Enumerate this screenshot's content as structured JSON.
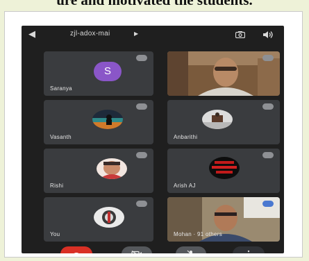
{
  "caption": "ure and motivated the students.",
  "meeting": {
    "code": "zjl-adox-mai",
    "back_icon": "back-arrow-icon",
    "camera_switch_icon": "camera-switch-icon",
    "speaker_icon": "speaker-icon"
  },
  "participants": [
    {
      "name": "Saranya",
      "type": "letter-avatar",
      "letter": "S",
      "color": "#8a56c8",
      "mic": "muted"
    },
    {
      "name": "",
      "type": "video",
      "mic": "muted"
    },
    {
      "name": "Vasanth",
      "type": "photo-avatar",
      "mic": "muted"
    },
    {
      "name": "Anbarithi",
      "type": "photo-avatar",
      "mic": "muted"
    },
    {
      "name": "Rishi",
      "type": "photo-avatar",
      "mic": "muted"
    },
    {
      "name": "Arish AJ",
      "type": "photo-avatar",
      "mic": "muted"
    },
    {
      "name": "You",
      "type": "photo-avatar",
      "mic": "muted"
    },
    {
      "name": "Mohan · 91 others",
      "type": "video",
      "mic": "speaking"
    }
  ],
  "controls": [
    {
      "icon": "hang-up-icon",
      "color": "#d93025"
    },
    {
      "icon": "camera-off-icon",
      "color": "#55585c"
    },
    {
      "icon": "mic-off-icon",
      "color": "#55585c"
    },
    {
      "icon": "more-options-icon",
      "color": "#303236"
    }
  ]
}
